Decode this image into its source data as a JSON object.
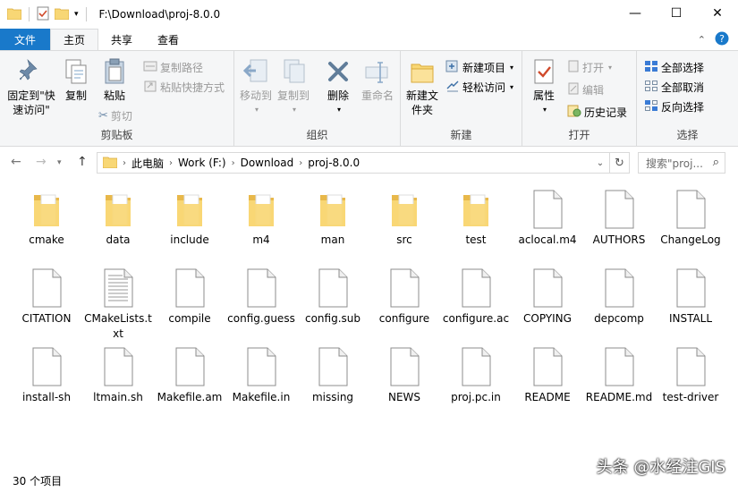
{
  "window": {
    "title": "F:\\Download\\proj-8.0.0",
    "controls": [
      "—",
      "☐",
      "✕"
    ]
  },
  "tabs": {
    "file": "文件",
    "home": "主页",
    "share": "共享",
    "view": "查看"
  },
  "ribbon": {
    "clipboard": {
      "label": "剪贴板",
      "pin": "固定到\"快速访问\"",
      "copy": "复制",
      "paste": "粘贴",
      "copy_path": "复制路径",
      "paste_shortcut": "粘贴快捷方式",
      "cut": "剪切"
    },
    "organize": {
      "label": "组织",
      "move_to": "移动到",
      "copy_to": "复制到",
      "delete": "删除",
      "rename": "重命名"
    },
    "new": {
      "label": "新建",
      "new_folder": "新建文件夹",
      "new_item": "新建项目",
      "easy_access": "轻松访问"
    },
    "open": {
      "label": "打开",
      "properties": "属性",
      "open": "打开",
      "edit": "编辑",
      "history": "历史记录"
    },
    "select": {
      "label": "选择",
      "select_all": "全部选择",
      "select_none": "全部取消",
      "invert": "反向选择"
    }
  },
  "address": {
    "crumbs": [
      "此电脑",
      "Work (F:)",
      "Download",
      "proj-8.0.0"
    ],
    "search_placeholder": "搜索\"proj..."
  },
  "files": [
    {
      "name": "cmake",
      "type": "folder"
    },
    {
      "name": "data",
      "type": "folder"
    },
    {
      "name": "include",
      "type": "folder"
    },
    {
      "name": "m4",
      "type": "folder"
    },
    {
      "name": "man",
      "type": "folder"
    },
    {
      "name": "src",
      "type": "folder"
    },
    {
      "name": "test",
      "type": "folder"
    },
    {
      "name": "aclocal.m4",
      "type": "file"
    },
    {
      "name": "AUTHORS",
      "type": "file"
    },
    {
      "name": "ChangeLog",
      "type": "file"
    },
    {
      "name": "CITATION",
      "type": "file"
    },
    {
      "name": "CMakeLists.txt",
      "type": "text"
    },
    {
      "name": "compile",
      "type": "file"
    },
    {
      "name": "config.guess",
      "type": "file"
    },
    {
      "name": "config.sub",
      "type": "file"
    },
    {
      "name": "configure",
      "type": "file"
    },
    {
      "name": "configure.ac",
      "type": "file"
    },
    {
      "name": "COPYING",
      "type": "file"
    },
    {
      "name": "depcomp",
      "type": "file"
    },
    {
      "name": "INSTALL",
      "type": "file"
    },
    {
      "name": "install-sh",
      "type": "file"
    },
    {
      "name": "ltmain.sh",
      "type": "file"
    },
    {
      "name": "Makefile.am",
      "type": "file"
    },
    {
      "name": "Makefile.in",
      "type": "file"
    },
    {
      "name": "missing",
      "type": "file"
    },
    {
      "name": "NEWS",
      "type": "file"
    },
    {
      "name": "proj.pc.in",
      "type": "file"
    },
    {
      "name": "README",
      "type": "file"
    },
    {
      "name": "README.md",
      "type": "file"
    },
    {
      "name": "test-driver",
      "type": "file"
    }
  ],
  "status": {
    "count": "30 个项目"
  },
  "watermark": "头条 @水经注GIS",
  "colors": {
    "accent": "#1979ca",
    "folder": "#f8d775",
    "folder_dark": "#e8b84a"
  }
}
